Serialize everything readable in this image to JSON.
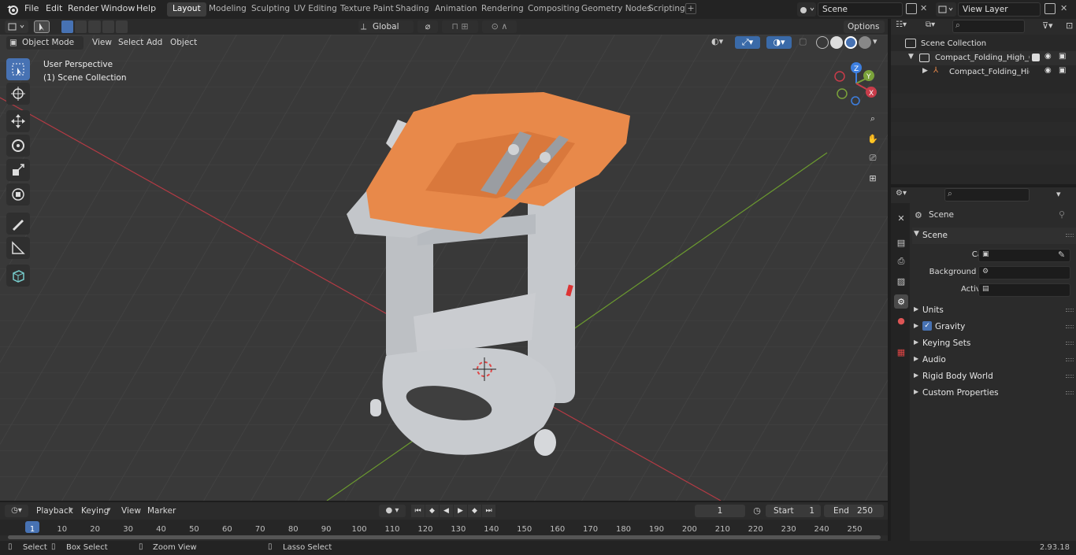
{
  "topbar": {
    "menus": [
      "File",
      "Edit",
      "Render",
      "Window",
      "Help"
    ],
    "workspaces": [
      "Layout",
      "Modeling",
      "Sculpting",
      "UV Editing",
      "Texture Paint",
      "Shading",
      "Animation",
      "Rendering",
      "Compositing",
      "Geometry Nodes",
      "Scripting"
    ],
    "active_workspace": "Layout",
    "scene_name": "Scene",
    "view_layer": "View Layer"
  },
  "viewport_header": {
    "mode": "Object Mode",
    "menus": [
      "View",
      "Select",
      "Add",
      "Object"
    ],
    "transform_orientation": "Global",
    "options_label": "Options"
  },
  "viewport": {
    "perspective_label": "User Perspective",
    "collection_label": "(1) Scene Collection",
    "gizmo_axes": [
      "Z",
      "Y",
      "X"
    ],
    "colors": {
      "x_axis": "#c83c4a",
      "y_axis": "#7aa23a",
      "z_axis": "#3d7fe0",
      "seat": "#e8894a",
      "chair": "#c5c8cc"
    }
  },
  "outliner": {
    "search_placeholder": "",
    "root": "Scene Collection",
    "items": [
      {
        "name": "Compact_Folding_High_Chair",
        "depth": 1
      },
      {
        "name": "Compact_Folding_High_C",
        "depth": 2
      }
    ]
  },
  "properties": {
    "breadcrumb": "Scene",
    "section": "Scene",
    "fields": [
      {
        "label": "Camera",
        "icon": "camera-icon"
      },
      {
        "label": "Background Scene",
        "icon": "scene-icon"
      },
      {
        "label": "Active Clip",
        "icon": "clip-icon"
      }
    ],
    "panels": [
      "Units",
      "Gravity",
      "Keying Sets",
      "Audio",
      "Rigid Body World",
      "Custom Properties"
    ]
  },
  "timeline": {
    "menus": [
      "Playback",
      "Keying",
      "View",
      "Marker"
    ],
    "current_frame": "1",
    "start_label": "Start",
    "start_value": "1",
    "end_label": "End",
    "end_value": "250",
    "ticks": [
      "1",
      "10",
      "20",
      "30",
      "40",
      "50",
      "60",
      "70",
      "80",
      "90",
      "100",
      "110",
      "120",
      "130",
      "140",
      "150",
      "160",
      "170",
      "180",
      "190",
      "200",
      "210",
      "220",
      "230",
      "240",
      "250"
    ]
  },
  "statusbar": {
    "hints": [
      "Select",
      "Box Select",
      "Zoom View",
      "Lasso Select"
    ],
    "version": "2.93.18"
  }
}
